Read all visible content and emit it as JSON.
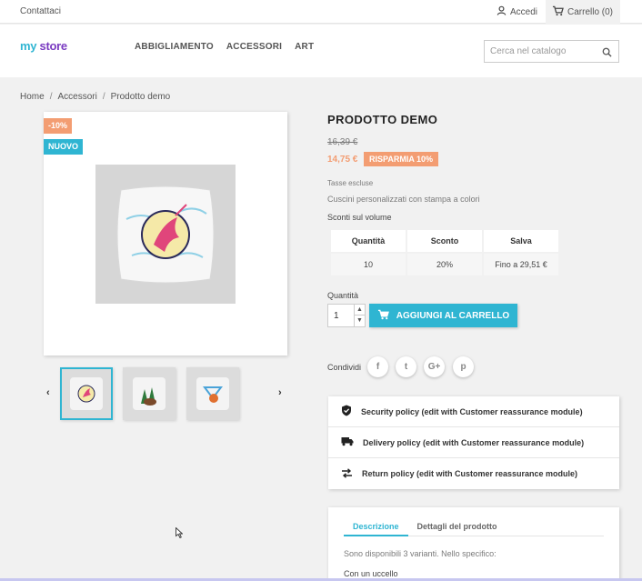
{
  "topbar": {
    "contact": "Contattaci",
    "login": "Accedi",
    "cart": "Carrello (0)"
  },
  "header": {
    "logo": {
      "part1": "my",
      "part2": " ",
      "part3": "store"
    },
    "nav": [
      "ABBIGLIAMENTO",
      "ACCESSORI",
      "ART"
    ],
    "search_placeholder": "Cerca nel catalogo"
  },
  "breadcrumb": [
    "Home",
    "Accessori",
    "Prodotto demo"
  ],
  "product": {
    "flags": {
      "discount": "-10%",
      "new": "NUOVO"
    },
    "title": "PRODOTTO DEMO",
    "old_price": "16,39 €",
    "price": "14,75 €",
    "save_badge": "RISPARMIA 10%",
    "tax": "Tasse escluse",
    "short_desc": "Cuscini personalizzati con stampa a colori",
    "volume_title": "Sconti sul volume",
    "volume_table": {
      "headers": [
        "Quantità",
        "Sconto",
        "Salva"
      ],
      "rows": [
        [
          "10",
          "20%",
          "Fino a 29,51 €"
        ]
      ]
    },
    "quantity_label": "Quantità",
    "quantity_value": "1",
    "add_to_cart": "AGGIUNGI AL CARRELLO",
    "share_label": "Condividi",
    "social": [
      "f",
      "t",
      "G+",
      "p"
    ]
  },
  "reassurance": [
    {
      "icon": "shield-icon",
      "text": "Security policy (edit with Customer reassurance module)"
    },
    {
      "icon": "truck-icon",
      "text": "Delivery policy (edit with Customer reassurance module)"
    },
    {
      "icon": "arrows-icon",
      "text": "Return policy (edit with Customer reassurance module)"
    }
  ],
  "description": {
    "tabs": [
      "Descrizione",
      "Dettagli del prodotto"
    ],
    "text1": "Sono disponibili 3 varianti. Nello specifico:",
    "text2": "Con un uccello"
  },
  "colors": {
    "accent": "#2fb5d2",
    "discount": "#f39d72",
    "background": "#f1f1f1"
  }
}
